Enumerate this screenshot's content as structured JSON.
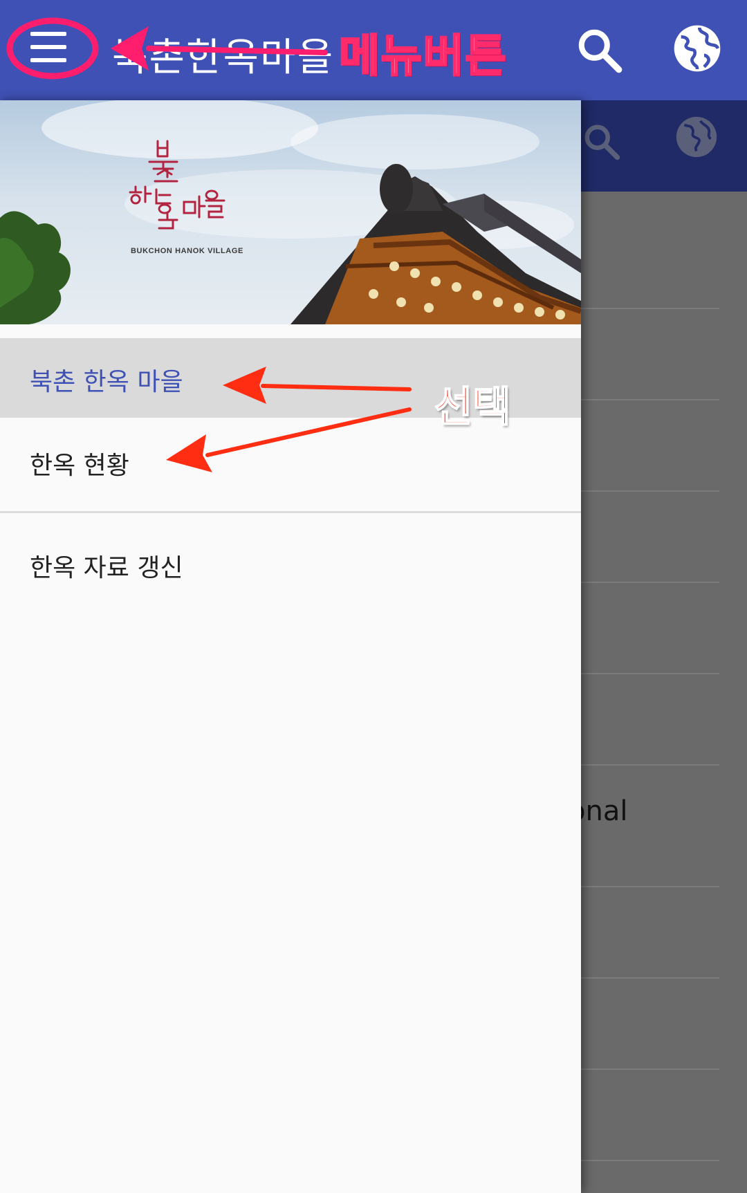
{
  "app_bar": {
    "title": "북촌한옥마을",
    "menu_icon": "hamburger-menu-icon",
    "search_icon": "search-icon",
    "language_icon": "globe-icon",
    "color": "#3f51b5"
  },
  "drawer": {
    "header": {
      "logo_text": "북촌 한옥마을",
      "logo_subtitle": "BUKCHON HANOK VILLAGE"
    },
    "items": [
      {
        "label": "북촌 한옥 마을",
        "selected": true
      },
      {
        "label": "한옥 현황",
        "selected": false
      },
      {
        "label": "한옥 자료 갱신",
        "selected": false
      }
    ]
  },
  "background_content": {
    "partial_text": "onal"
  },
  "annotations": {
    "menu_button_label": "메뉴버튼",
    "select_label": "선택",
    "annotation_color": "#ff2b6b",
    "arrow_color": "#ff2e12"
  }
}
